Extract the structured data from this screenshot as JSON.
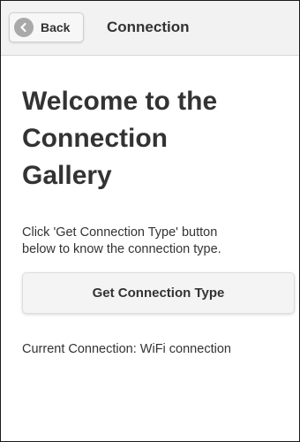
{
  "header": {
    "back_label": "Back",
    "back_icon": "back-arrow-icon",
    "title": "Connection"
  },
  "main": {
    "title_lines": [
      "Welcome to the",
      "Connection",
      "Gallery"
    ],
    "instructions_lines": [
      "Click 'Get Connection Type' button",
      "below to know the connection type."
    ],
    "button_label": "Get Connection Type",
    "current_connection": "Current Connection: WiFi connection"
  },
  "colors": {
    "header_bg": "#f2f2f2",
    "text": "#333333",
    "back_icon_bg": "#a9a9a9"
  }
}
